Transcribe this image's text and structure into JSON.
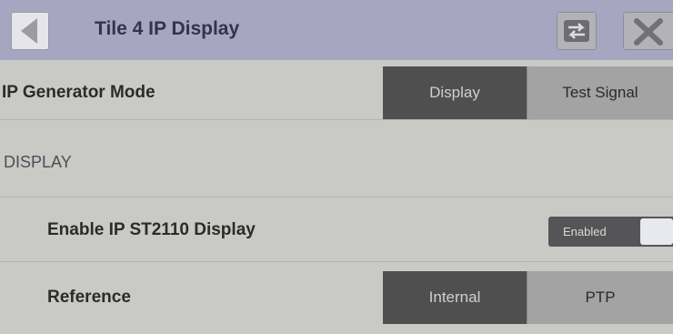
{
  "header": {
    "title": "Tile 4 IP Display"
  },
  "generator_mode": {
    "label": "IP Generator Mode",
    "options": [
      "Display",
      "Test Signal"
    ],
    "selected": "Display"
  },
  "section": {
    "label": "DISPLAY"
  },
  "enable_display": {
    "label": "Enable IP ST2110 Display",
    "toggle_text": "Enabled",
    "state": true
  },
  "reference": {
    "label": "Reference",
    "options": [
      "Internal",
      "PTP"
    ],
    "selected": "Internal"
  },
  "icons": {
    "back": "back-arrow-icon",
    "swap": "swap-arrows-icon",
    "close": "close-x-icon"
  },
  "colors": {
    "titlebar": "#a6a6c0",
    "active_segment": "#4f4f4f",
    "inactive_segment": "#a3a3a3"
  }
}
